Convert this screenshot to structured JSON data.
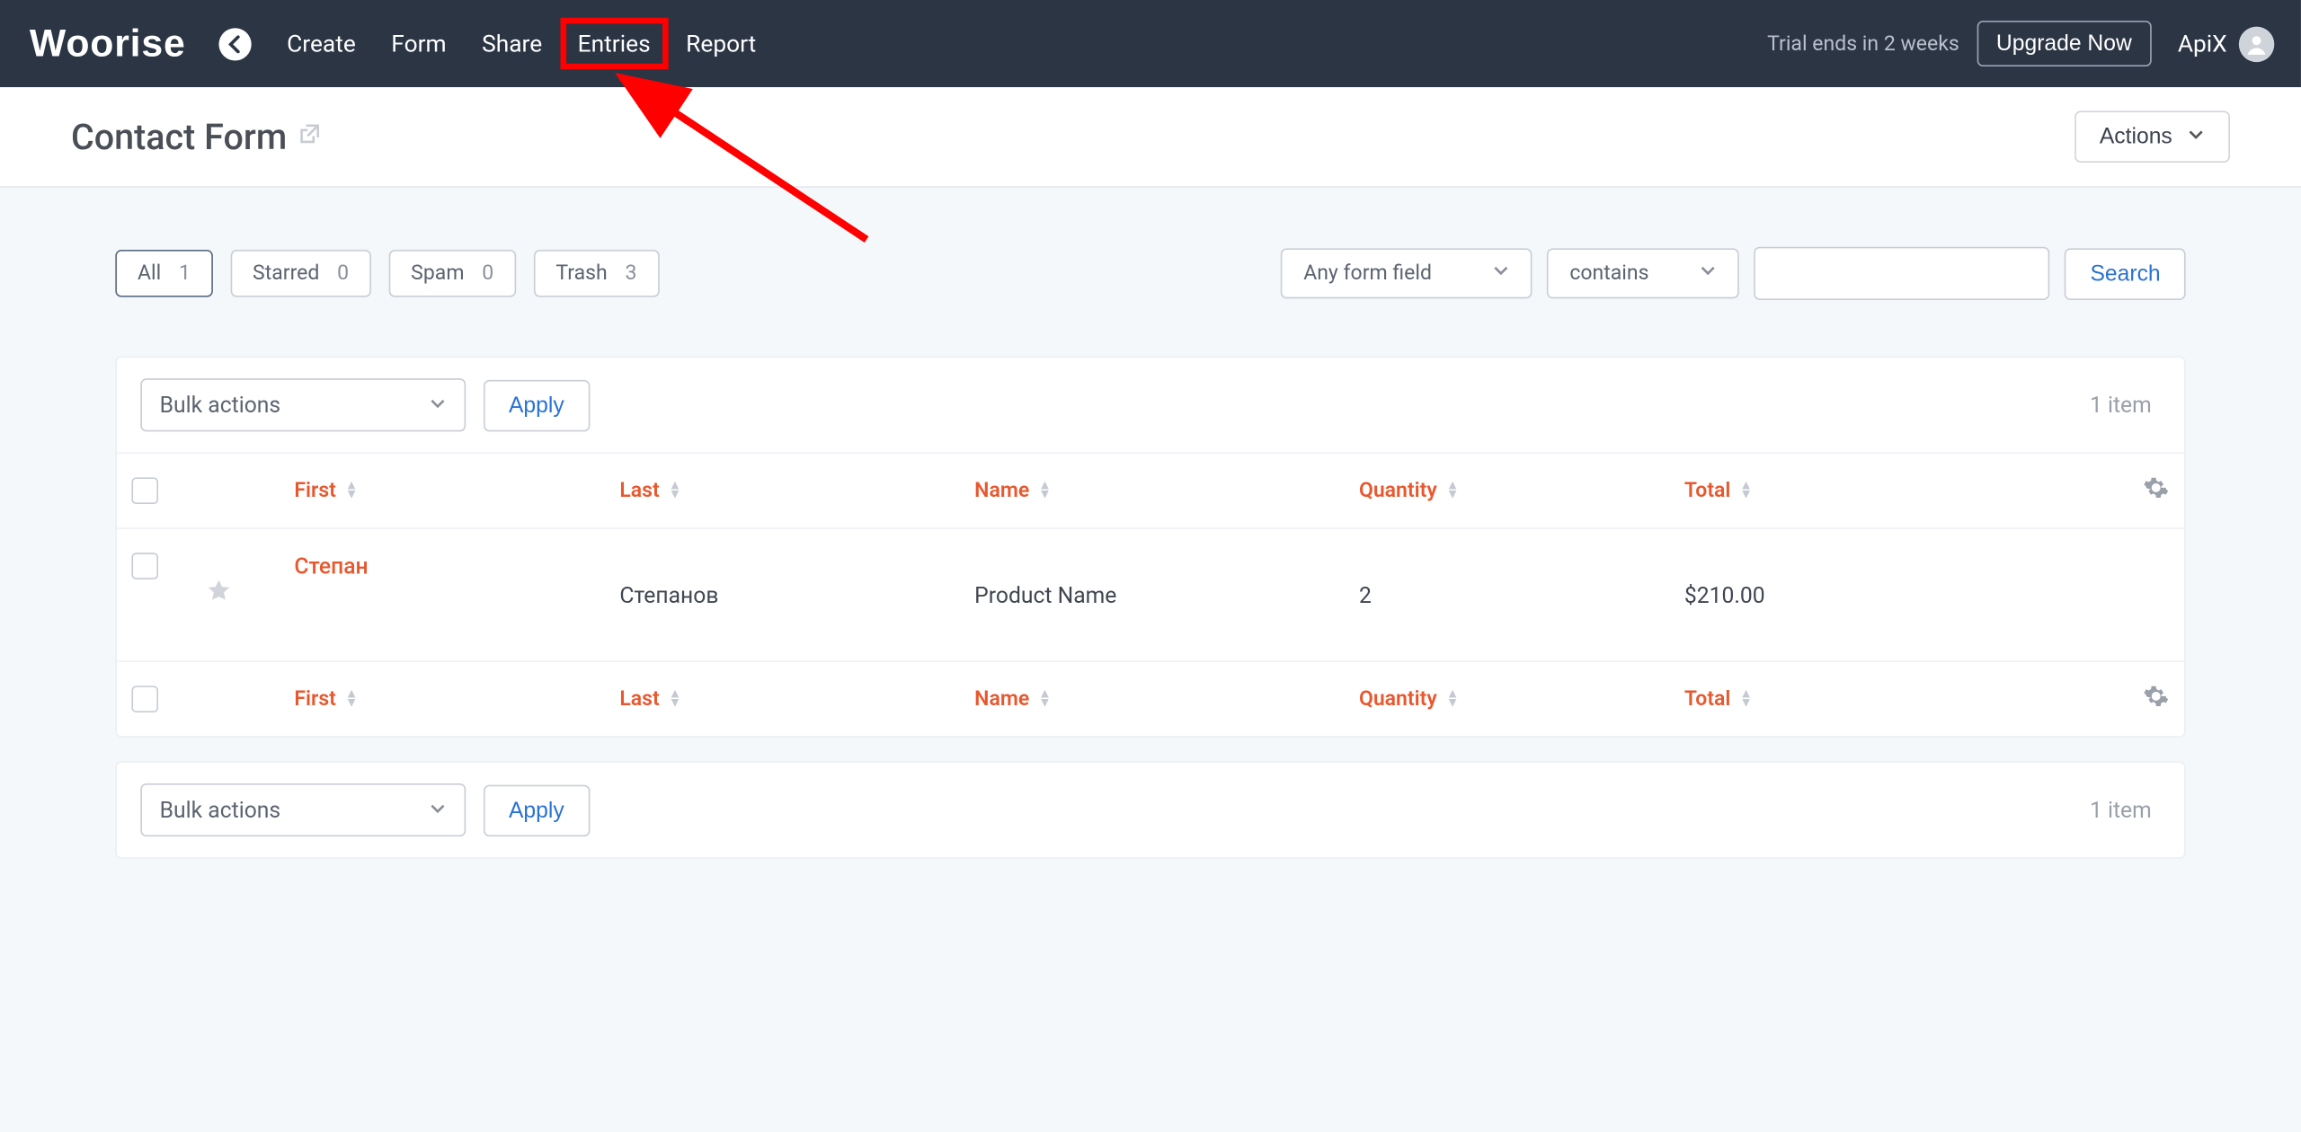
{
  "brand": "Woorise",
  "nav": {
    "items": [
      "Create",
      "Form",
      "Share",
      "Entries",
      "Report"
    ],
    "highlighted_index": 3
  },
  "trial_notice": "Trial ends in 2 weeks",
  "upgrade_label": "Upgrade Now",
  "user_name": "ApiX",
  "page_title": "Contact Form",
  "actions_label": "Actions",
  "filters": {
    "tabs": [
      {
        "label": "All",
        "count": "1",
        "active": true
      },
      {
        "label": "Starred",
        "count": "0",
        "active": false
      },
      {
        "label": "Spam",
        "count": "0",
        "active": false
      },
      {
        "label": "Trash",
        "count": "3",
        "active": false
      }
    ],
    "field_select": "Any form field",
    "op_select": "contains",
    "search_button": "Search"
  },
  "bulk": {
    "label": "Bulk actions",
    "apply": "Apply"
  },
  "item_count_text": "1 item",
  "columns": [
    "First",
    "Last",
    "Name",
    "Quantity",
    "Total"
  ],
  "rows": [
    {
      "first": "Степан",
      "last": "Степанов",
      "name": "Product Name",
      "quantity": "2",
      "total": "$210.00"
    }
  ]
}
